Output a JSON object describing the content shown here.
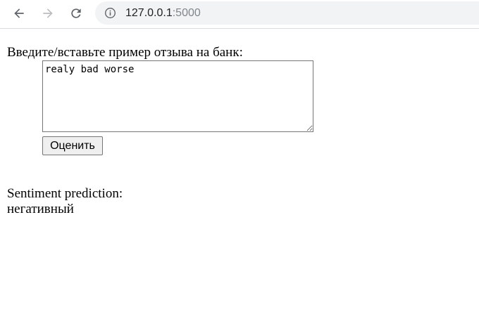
{
  "browser": {
    "url_host": "127.0.0.1",
    "url_port": ":5000",
    "icons": [
      "back-arrow-icon",
      "forward-arrow-icon",
      "reload-icon",
      "info-icon"
    ]
  },
  "form": {
    "prompt_label": "Введите/вставьте пример отзыва на банк:",
    "review_text": "realy bad worse",
    "submit_label": "Оценить"
  },
  "result": {
    "label": "Sentiment prediction:",
    "value": "негативный"
  },
  "colors": {
    "toolbar_bg": "#ffffff",
    "omnibox_bg": "#f1f3f4",
    "icon_active": "#5f6368",
    "icon_disabled": "#babcbe",
    "button_bg": "#efefef"
  }
}
